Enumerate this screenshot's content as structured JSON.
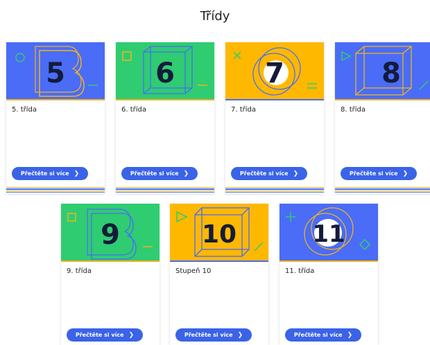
{
  "page": {
    "title": "Třídy"
  },
  "cards": [
    {
      "number": "5",
      "label": "5. třída",
      "button": "Přečtěte si více",
      "bg": "#4a6cf7"
    },
    {
      "number": "6",
      "label": "6. třída",
      "button": "Přečtěte si více",
      "bg": "#2fcc71"
    },
    {
      "number": "7",
      "label": "7. třída",
      "button": "Přečtěte si více",
      "bg": "#ffb800"
    },
    {
      "number": "8",
      "label": "8. třída",
      "button": "Přečtěte si více",
      "bg": "#4a6cf7"
    },
    {
      "number": "9",
      "label": "9. třída",
      "button": "Přečtěte si více",
      "bg": "#2fcc71"
    },
    {
      "number": "10",
      "label": "Stupeň 10",
      "button": "Přečtěte si více",
      "bg": "#ffb800"
    },
    {
      "number": "11",
      "label": "11. třída",
      "button": "Přečtěte si více",
      "bg": "#4a6cf7"
    }
  ],
  "colors": {
    "accent_blue": "#3a63e8",
    "yellow": "#ffb800",
    "green": "#2fcc71",
    "blue": "#4a6cf7",
    "navy": "#141b3a"
  }
}
